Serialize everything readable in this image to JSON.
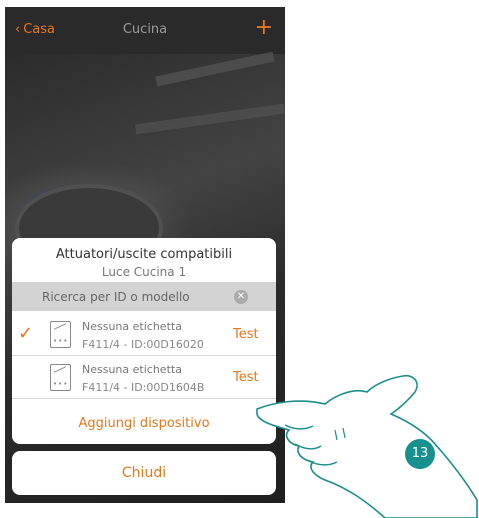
{
  "header": {
    "back_label": "Casa",
    "title": "Cucina",
    "add_symbol": "+"
  },
  "dialog": {
    "title": "Attuatori/uscite compatibili",
    "subtitle": "Luce Cucina 1",
    "search": {
      "placeholder": "Ricerca per ID o modello"
    },
    "devices": [
      {
        "name": "Nessuna etichetta",
        "id": "F411/4 - ID:00D16020",
        "selected": true,
        "test_label": "Test"
      },
      {
        "name": "Nessuna etichetta",
        "id": "F411/4 - ID:00D1604B",
        "selected": false,
        "test_label": "Test"
      }
    ],
    "add_label": "Aggiungi dispositivo"
  },
  "close_label": "Chiudi",
  "step_number": "13",
  "colors": {
    "accent": "#e8761a",
    "step_badge": "#16918d"
  },
  "icons": [
    "chevron-left-icon",
    "plus-icon",
    "clear-icon",
    "checkmark-icon",
    "actuator-device-icon",
    "hand-pointer-icon"
  ]
}
